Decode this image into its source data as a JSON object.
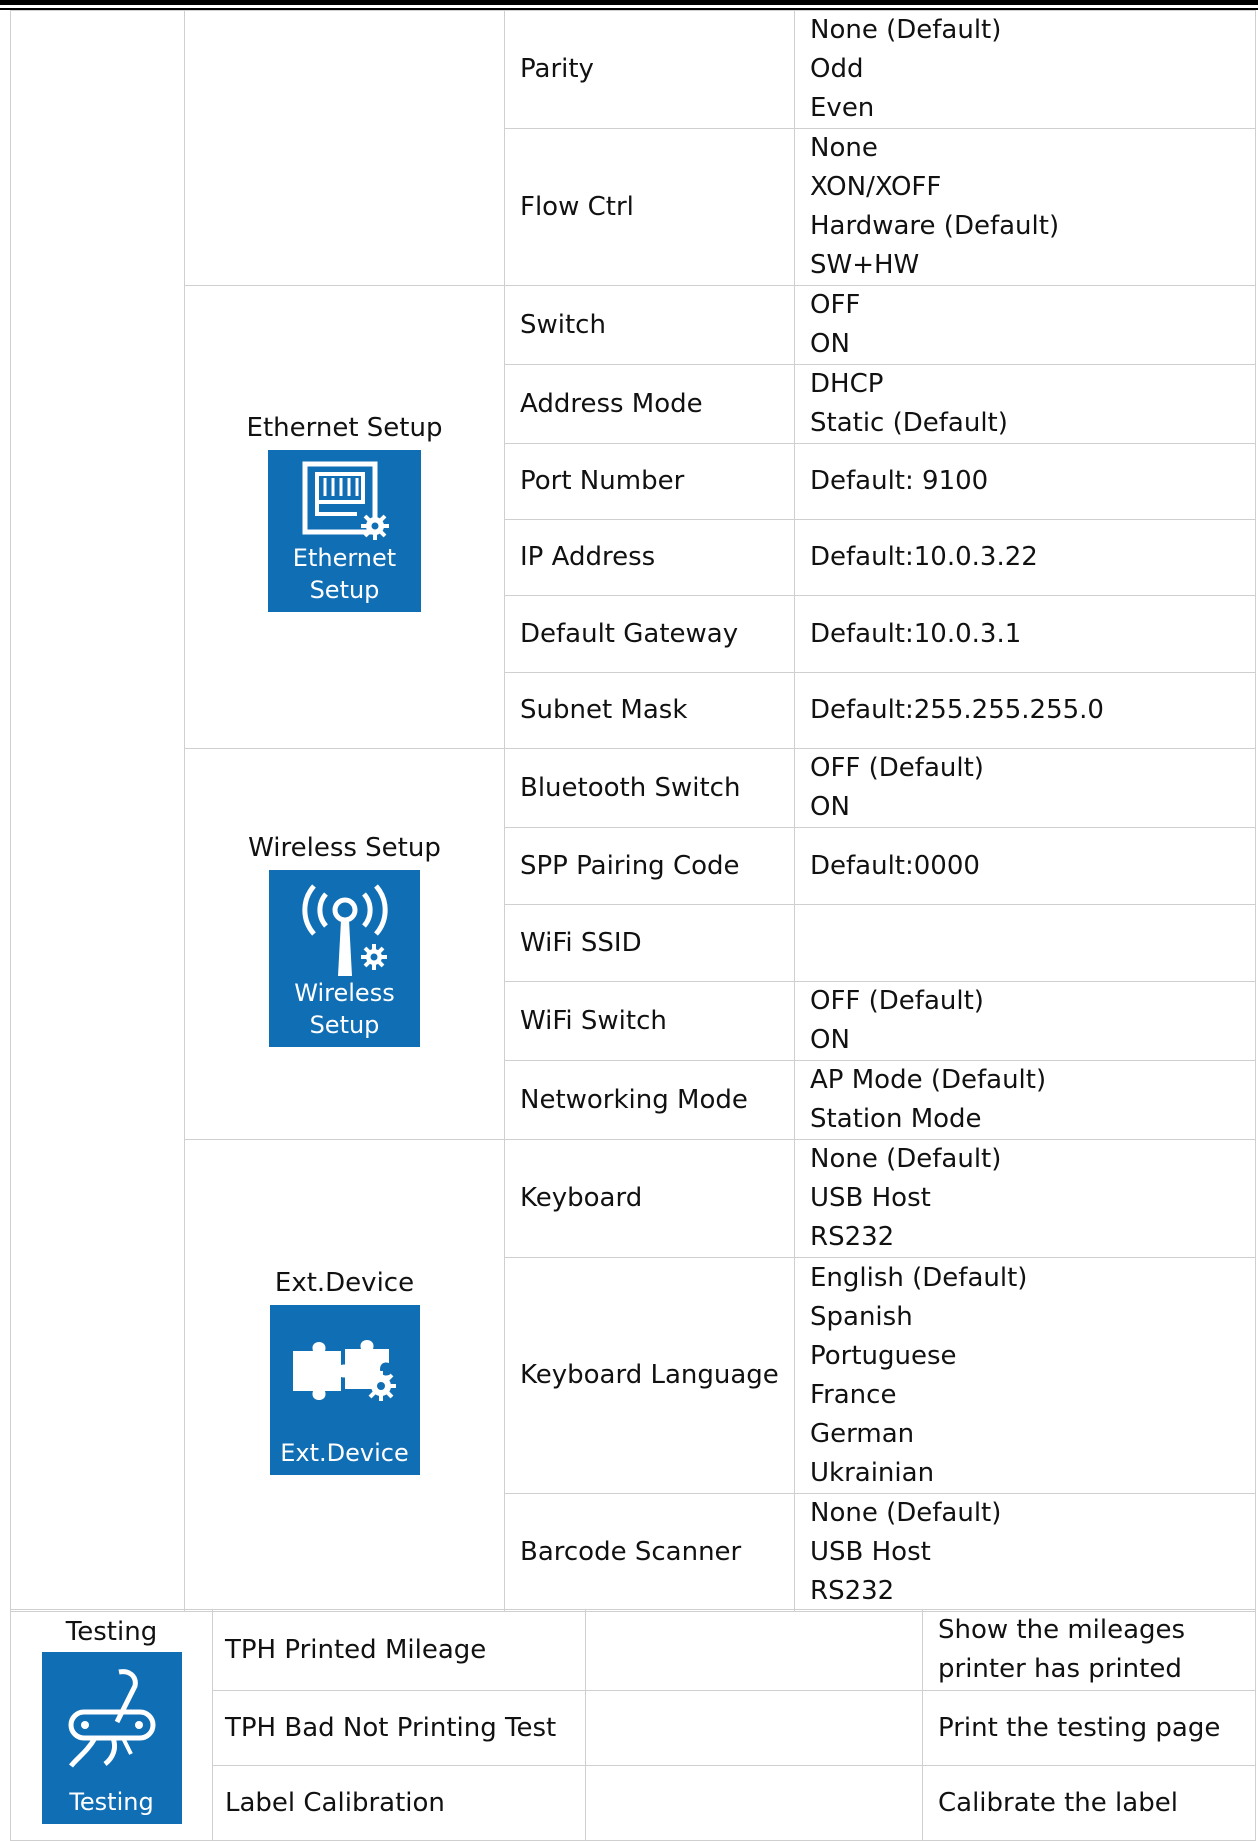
{
  "rows": {
    "parity": {
      "label": "Parity",
      "values": [
        "None (Default)",
        "Odd",
        "Even"
      ]
    },
    "flow_ctrl": {
      "label": "Flow Ctrl",
      "values": [
        "None",
        "XON/XOFF",
        "Hardware (Default)",
        "SW+HW"
      ]
    },
    "switch": {
      "label": "Switch",
      "values": [
        "OFF",
        "ON"
      ]
    },
    "address_mode": {
      "label": "Address Mode",
      "values": [
        "DHCP",
        "Static (Default)"
      ]
    },
    "port_number": {
      "label": "Port Number",
      "values": [
        "Default: 9100"
      ]
    },
    "ip_address": {
      "label": "IP Address",
      "values": [
        "Default:10.0.3.22"
      ]
    },
    "default_gateway": {
      "label": "Default Gateway",
      "values": [
        "Default:10.0.3.1"
      ]
    },
    "subnet_mask": {
      "label": "Subnet Mask",
      "values": [
        "Default:255.255.255.0"
      ]
    },
    "bt_switch": {
      "label": "Bluetooth Switch",
      "values": [
        "OFF (Default)",
        "ON"
      ]
    },
    "spp_code": {
      "label": "SPP Pairing Code",
      "values": [
        "Default:0000"
      ]
    },
    "wifi_ssid": {
      "label": "WiFi SSID",
      "values": []
    },
    "wifi_switch": {
      "label": "WiFi Switch",
      "values": [
        "OFF (Default)",
        "ON"
      ]
    },
    "net_mode": {
      "label": "Networking Mode",
      "values": [
        "AP Mode (Default)",
        "Station Mode"
      ]
    },
    "keyboard": {
      "label": "Keyboard",
      "values": [
        "None (Default)",
        "USB Host",
        "RS232"
      ]
    },
    "kb_lang": {
      "label": "Keyboard Language",
      "values": [
        "English (Default)",
        "Spanish",
        "Portuguese",
        "France",
        "German",
        "Ukrainian"
      ]
    },
    "barcode": {
      "label": "Barcode Scanner",
      "values": [
        "None (Default)",
        "USB Host",
        "RS232"
      ]
    },
    "tph_mileage": {
      "label": "TPH Printed Mileage",
      "values": [
        "Show the mileages",
        "printer has printed"
      ]
    },
    "tph_bad": {
      "label": "TPH Bad Not Printing Test",
      "values": [
        "Print the testing page"
      ]
    },
    "label_cal": {
      "label": "Label Calibration",
      "values": [
        "Calibrate the label"
      ]
    }
  },
  "sections": {
    "ethernet": {
      "label": "Ethernet Setup",
      "tile_lines": [
        "Ethernet",
        "Setup"
      ],
      "icon": "ethernet-port-gear-icon"
    },
    "wireless": {
      "label": "Wireless Setup",
      "tile_lines": [
        "Wireless",
        "Setup"
      ],
      "icon": "antenna-gear-icon"
    },
    "ext_device": {
      "label": "Ext.Device",
      "tile_lines": [
        "Ext.Device"
      ],
      "icon": "puzzle-gear-icon"
    },
    "testing": {
      "label": "Testing",
      "tile_lines": [
        "Testing"
      ],
      "icon": "tools-icon"
    }
  },
  "colors": {
    "tile_blue": "#0F6EB4",
    "border": "#cfcfcf"
  }
}
